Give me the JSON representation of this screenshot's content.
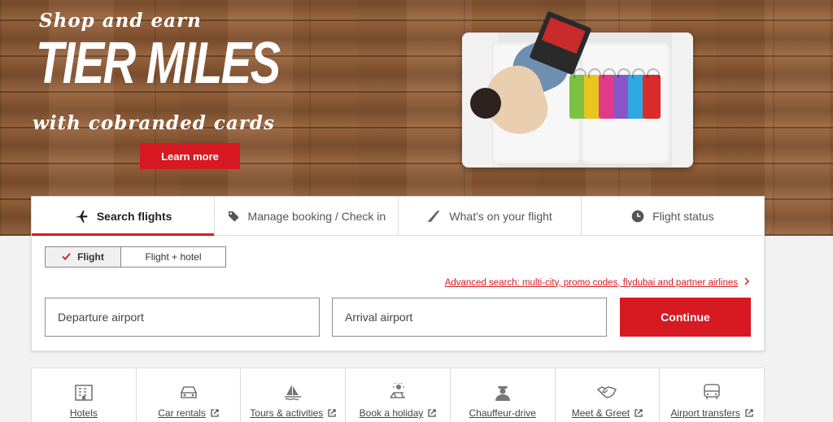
{
  "hero": {
    "line1": "Shop and earn",
    "line2": "TIER MILES",
    "line3": "with cobranded cards",
    "cta": "Learn more"
  },
  "tabs": [
    {
      "label": "Search flights",
      "icon": "airplane-icon",
      "active": true
    },
    {
      "label": "Manage booking / Check in",
      "icon": "tag-icon",
      "active": false
    },
    {
      "label": "What's on your flight",
      "icon": "wing-icon",
      "active": false
    },
    {
      "label": "Flight status",
      "icon": "clock-icon",
      "active": false
    }
  ],
  "trip_type": {
    "options": [
      "Flight",
      "Flight + hotel"
    ],
    "selected": "Flight"
  },
  "advanced_search": "Advanced search: multi-city, promo codes, flydubai and partner airlines",
  "fields": {
    "departure_placeholder": "Departure airport",
    "arrival_placeholder": "Arrival airport"
  },
  "continue_label": "Continue",
  "services": [
    {
      "label": "Hotels",
      "icon": "hotel-icon",
      "external": false
    },
    {
      "label": "Car rentals",
      "icon": "car-icon",
      "external": true
    },
    {
      "label": "Tours & activities",
      "icon": "sailboat-icon",
      "external": true
    },
    {
      "label": "Book a holiday",
      "icon": "beach-chair-icon",
      "external": true
    },
    {
      "label": "Chauffeur-drive",
      "icon": "chauffeur-icon",
      "external": false
    },
    {
      "label": "Meet & Greet",
      "icon": "handshake-icon",
      "external": true
    },
    {
      "label": "Airport transfers",
      "icon": "bus-icon",
      "external": true
    }
  ],
  "colors": {
    "brand_red": "#d71921",
    "page_bg": "#f2f2f2",
    "wood": "#8a5a36"
  }
}
